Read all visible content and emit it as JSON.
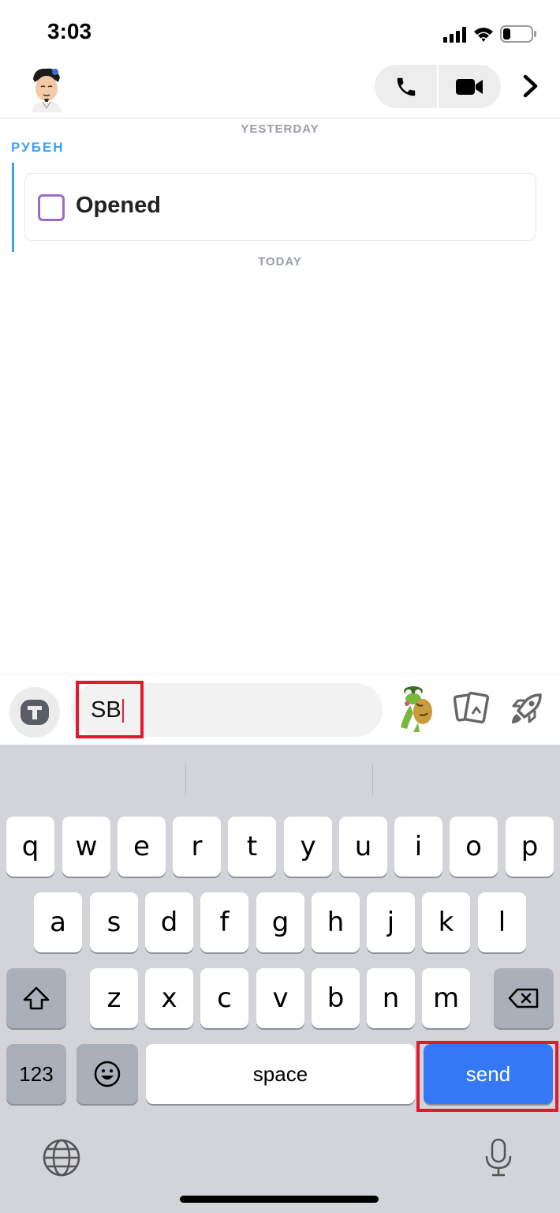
{
  "status_bar": {
    "time": "3:03"
  },
  "header": {
    "avatar_icon": "bitmoji-avatar",
    "call_icon": "phone-icon",
    "video_icon": "video-camera-icon",
    "more_icon": "chevron-right-icon"
  },
  "chat": {
    "day_yesterday": "YESTERDAY",
    "sender": "РУБЕН",
    "snap_status": "Opened",
    "snap_status_color": "#9a6bc8",
    "sender_color": "#3ea0f0",
    "day_today": "TODAY"
  },
  "composer": {
    "input_value": "SB",
    "text_tool_icon": "text-tool-icon",
    "sticker_icon": "frog-sticker",
    "cards_icon": "cards-icon",
    "rocket_icon": "rocket-icon"
  },
  "keyboard": {
    "row1": [
      "q",
      "w",
      "e",
      "r",
      "t",
      "y",
      "u",
      "i",
      "o",
      "p"
    ],
    "row2": [
      "a",
      "s",
      "d",
      "f",
      "g",
      "h",
      "j",
      "k",
      "l"
    ],
    "row3": [
      "z",
      "x",
      "c",
      "v",
      "b",
      "n",
      "m"
    ],
    "numbers_label": "123",
    "space_label": "space",
    "send_label": "send",
    "send_color": "#3478f6"
  }
}
